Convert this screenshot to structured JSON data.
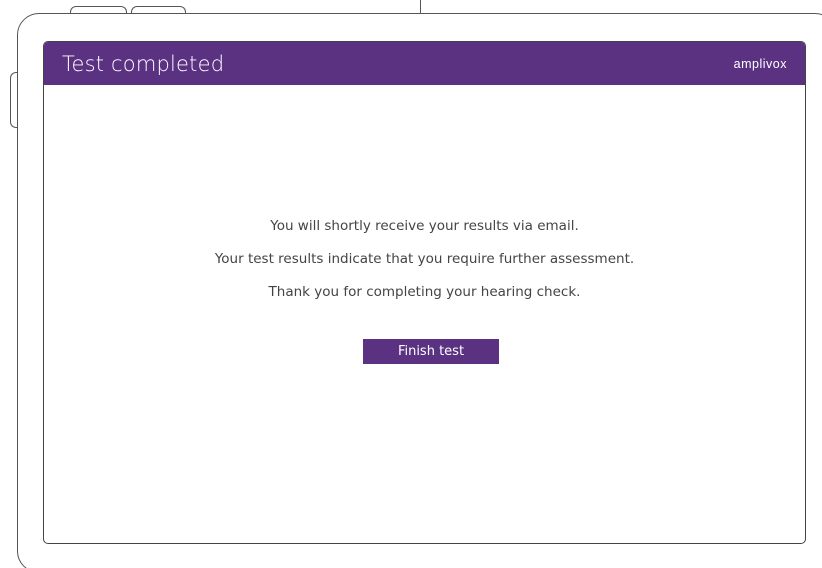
{
  "header": {
    "title": "Test completed",
    "brand": "amplivox"
  },
  "messages": {
    "line1": "You will shortly receive your results via email.",
    "line2": "Your test results indicate that you require further assessment.",
    "line3": "Thank you for completing your hearing check."
  },
  "actions": {
    "finish_label": "Finish test"
  },
  "colors": {
    "accent": "#5b3282",
    "text": "#444444"
  }
}
